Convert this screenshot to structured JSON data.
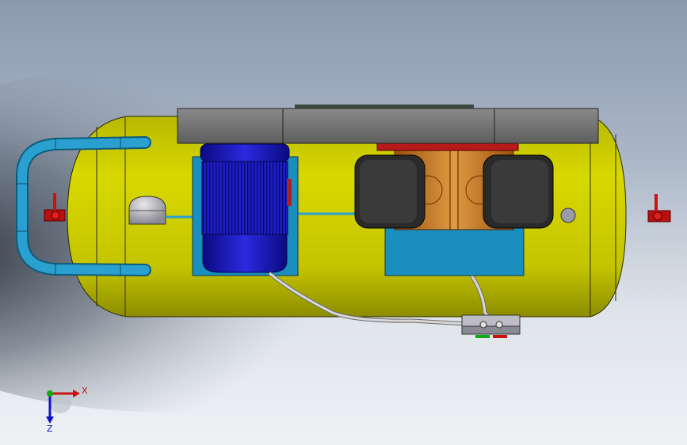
{
  "viewport": {
    "background_top": "#8e9cb0",
    "background_mid": "#d6dde6",
    "background_bottom": "#eef1f4"
  },
  "model": {
    "tank_color": "#c9c800",
    "tank_shade": "#9a9a00",
    "motor_color": "#1a1acc",
    "motor_dark": "#0a0a7a",
    "base_plate_color": "#1a8fbf",
    "pump_block_color": "#c87a2a",
    "cover_color": "#7a7a7a",
    "pipe_color": "#2aa0d0",
    "valve_color": "#cc1111",
    "hose_color": "#d0d0d0"
  },
  "triad": {
    "x_label": "X",
    "z_label": "Z",
    "x_color": "#cc1111",
    "z_color": "#1111cc",
    "origin_color": "#11aa11"
  }
}
